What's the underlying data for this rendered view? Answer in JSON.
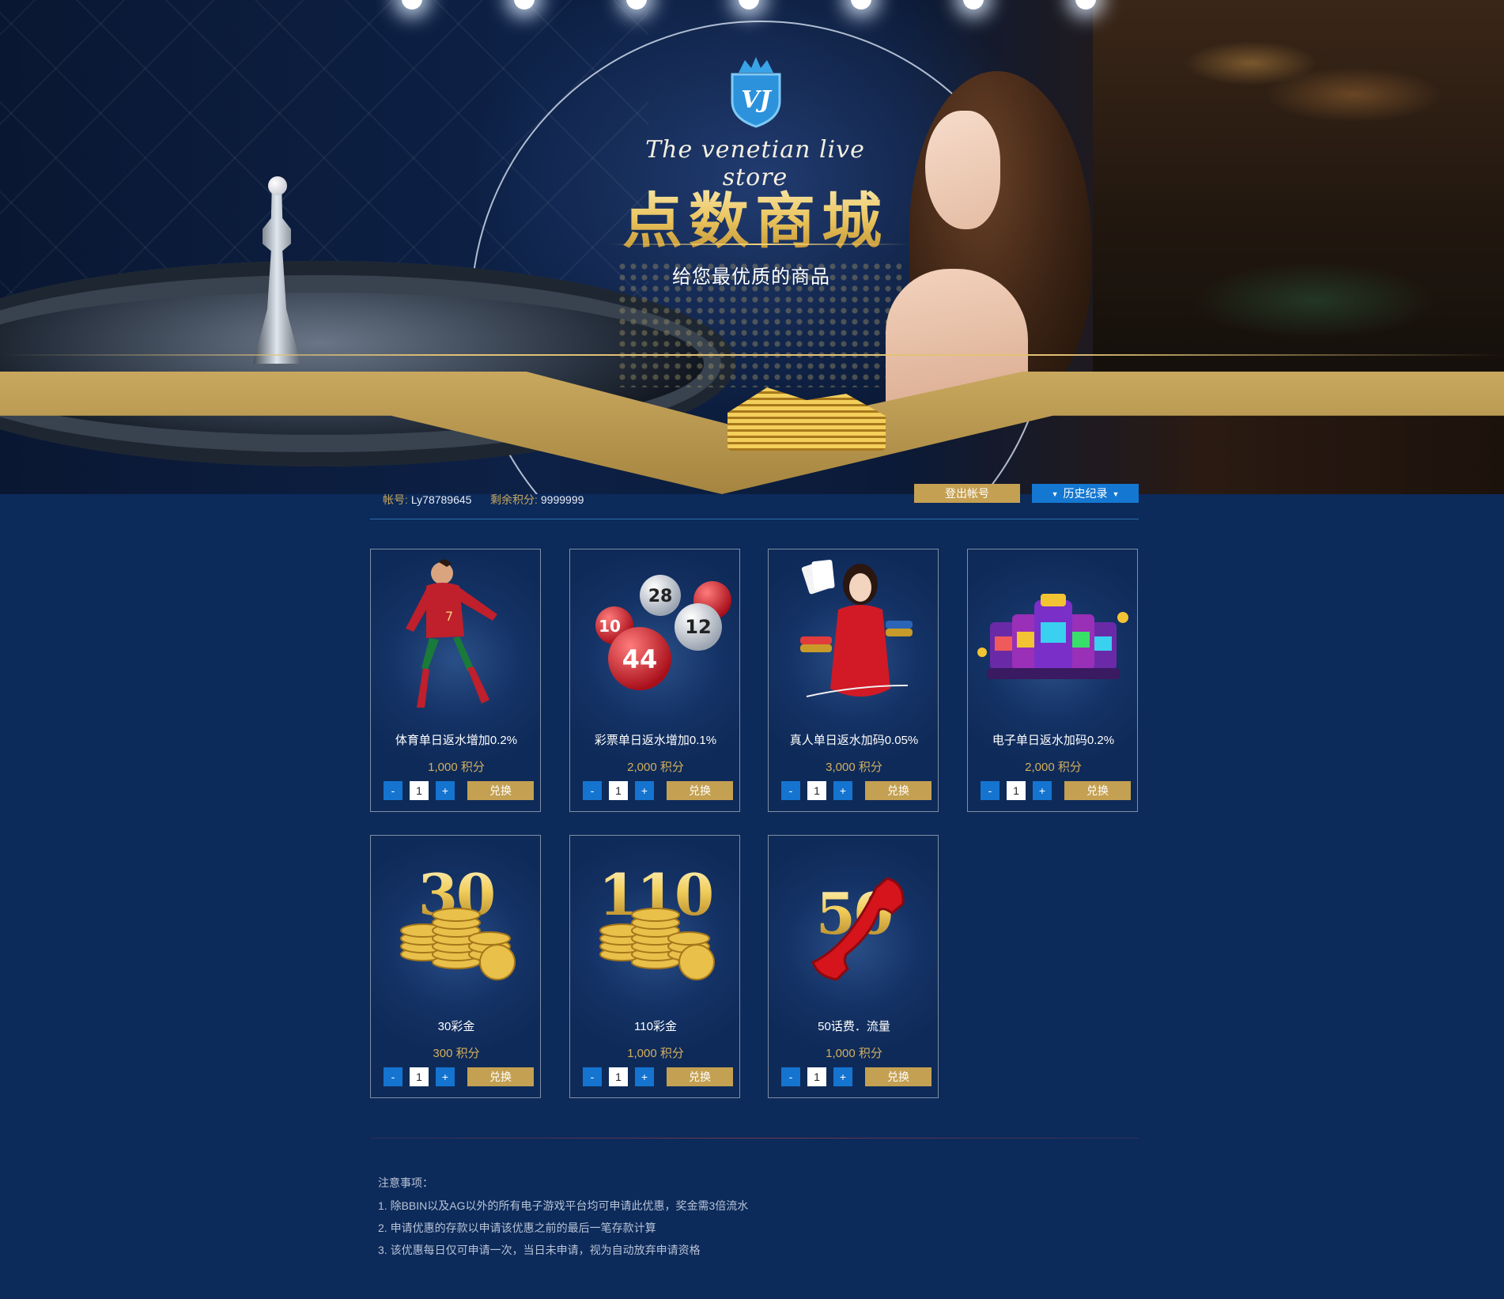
{
  "hero": {
    "tagline_en": "The venetian live store",
    "title": "点数商城",
    "subtitle": "给您最优质的商品",
    "logo_text": "VJ"
  },
  "account": {
    "account_label": "帐号:",
    "account_value": "Ly78789645",
    "points_label": "剩余积分:",
    "points_value": "9999999",
    "logout_label": "登出帐号",
    "history_label": "历史纪录"
  },
  "products": [
    {
      "name": "体育单日返水增加0.2%",
      "price": "1,000 积分",
      "qty": "1",
      "minus": "-",
      "plus": "+",
      "redeem": "兑换",
      "icon": "soccer-player-icon"
    },
    {
      "name": "彩票单日返水增加0.1%",
      "price": "2,000 积分",
      "qty": "1",
      "minus": "-",
      "plus": "+",
      "redeem": "兑换",
      "icon": "lottery-balls-icon",
      "balls": [
        "28",
        "12",
        "44",
        "10"
      ]
    },
    {
      "name": "真人单日返水加码0.05%",
      "price": "3,000 积分",
      "qty": "1",
      "minus": "-",
      "plus": "+",
      "redeem": "兑换",
      "icon": "live-dealer-icon"
    },
    {
      "name": "电子单日返水加码0.2%",
      "price": "2,000 积分",
      "qty": "1",
      "minus": "-",
      "plus": "+",
      "redeem": "兑换",
      "icon": "slot-machine-icon"
    },
    {
      "name": "30彩金",
      "price": "300 积分",
      "qty": "1",
      "minus": "-",
      "plus": "+",
      "redeem": "兑换",
      "icon": "gold-coins-icon",
      "art_number": "30"
    },
    {
      "name": "110彩金",
      "price": "1,000 积分",
      "qty": "1",
      "minus": "-",
      "plus": "+",
      "redeem": "兑换",
      "icon": "gold-coins-icon",
      "art_number": "110"
    },
    {
      "name": "50话费．流量",
      "price": "1,000 积分",
      "qty": "1",
      "minus": "-",
      "plus": "+",
      "redeem": "兑换",
      "icon": "phone-handset-icon",
      "art_number": "50"
    }
  ],
  "notes": {
    "heading": "注意事项：",
    "lines": [
      "1. 除BBIN以及AG以外的所有电子游戏平台均可申请此优惠，奖金需3倍流水",
      "2. 申请优惠的存款以申请该优惠之前的最后一笔存款计算",
      "3. 该优惠每日仅可申请一次，当日未申请，视为自动放弃申请资格"
    ]
  },
  "colors": {
    "page_bg": "#0c2a5a",
    "gold": "#c4a052",
    "accent_blue": "#1478d2",
    "price_gold": "#d4af5f"
  }
}
